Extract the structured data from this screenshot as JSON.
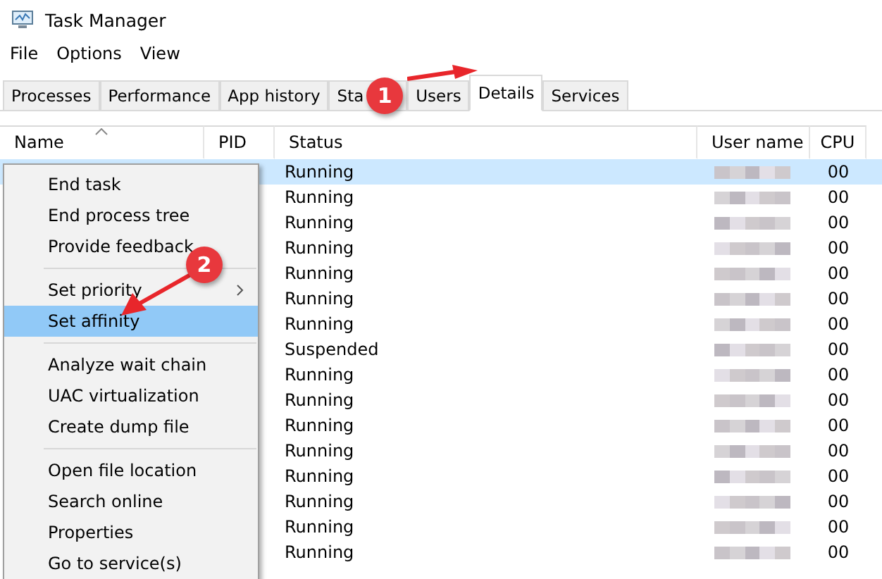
{
  "window": {
    "title": "Task Manager"
  },
  "menu": [
    "File",
    "Options",
    "View"
  ],
  "tabs": [
    {
      "label": "Processes",
      "selected": false
    },
    {
      "label": "Performance",
      "selected": false
    },
    {
      "label": "App history",
      "selected": false
    },
    {
      "label": "Sta",
      "selected": false
    },
    {
      "label": "Users",
      "selected": false
    },
    {
      "label": "Details",
      "selected": true
    },
    {
      "label": "Services",
      "selected": false
    }
  ],
  "table": {
    "columns": [
      {
        "label": "Name",
        "sorted": true
      },
      {
        "label": "PID",
        "sorted": false
      },
      {
        "label": "Status",
        "sorted": false
      },
      {
        "label": "User name",
        "sorted": false
      },
      {
        "label": "CPU",
        "sorted": false
      }
    ],
    "rows": [
      {
        "status": "Running",
        "cpu": "00",
        "selected": true
      },
      {
        "status": "Running",
        "cpu": "00",
        "selected": false
      },
      {
        "status": "Running",
        "cpu": "00",
        "selected": false
      },
      {
        "status": "Running",
        "cpu": "00",
        "selected": false
      },
      {
        "status": "Running",
        "cpu": "00",
        "selected": false
      },
      {
        "status": "Running",
        "cpu": "00",
        "selected": false
      },
      {
        "status": "Running",
        "cpu": "00",
        "selected": false
      },
      {
        "status": "Suspended",
        "cpu": "00",
        "selected": false
      },
      {
        "status": "Running",
        "cpu": "00",
        "selected": false
      },
      {
        "status": "Running",
        "cpu": "00",
        "selected": false
      },
      {
        "status": "Running",
        "cpu": "00",
        "selected": false
      },
      {
        "status": "Running",
        "cpu": "00",
        "selected": false
      },
      {
        "status": "Running",
        "cpu": "00",
        "selected": false
      },
      {
        "status": "Running",
        "cpu": "00",
        "selected": false
      },
      {
        "status": "Running",
        "cpu": "00",
        "selected": false
      },
      {
        "status": "Running",
        "cpu": "00",
        "selected": false
      }
    ]
  },
  "context_menu": {
    "groups": [
      [
        {
          "label": "End task",
          "submenu": false,
          "selected": false
        },
        {
          "label": "End process tree",
          "submenu": false,
          "selected": false
        },
        {
          "label": "Provide feedback",
          "submenu": false,
          "selected": false
        }
      ],
      [
        {
          "label": "Set priority",
          "submenu": true,
          "selected": false
        },
        {
          "label": "Set affinity",
          "submenu": false,
          "selected": true
        }
      ],
      [
        {
          "label": "Analyze wait chain",
          "submenu": false,
          "selected": false
        },
        {
          "label": "UAC virtualization",
          "submenu": false,
          "selected": false
        },
        {
          "label": "Create dump file",
          "submenu": false,
          "selected": false
        }
      ],
      [
        {
          "label": "Open file location",
          "submenu": false,
          "selected": false
        },
        {
          "label": "Search online",
          "submenu": false,
          "selected": false
        },
        {
          "label": "Properties",
          "submenu": false,
          "selected": false
        },
        {
          "label": "Go to service(s)",
          "submenu": false,
          "selected": false
        }
      ]
    ]
  },
  "annotations": [
    {
      "number": "1"
    },
    {
      "number": "2"
    }
  ]
}
